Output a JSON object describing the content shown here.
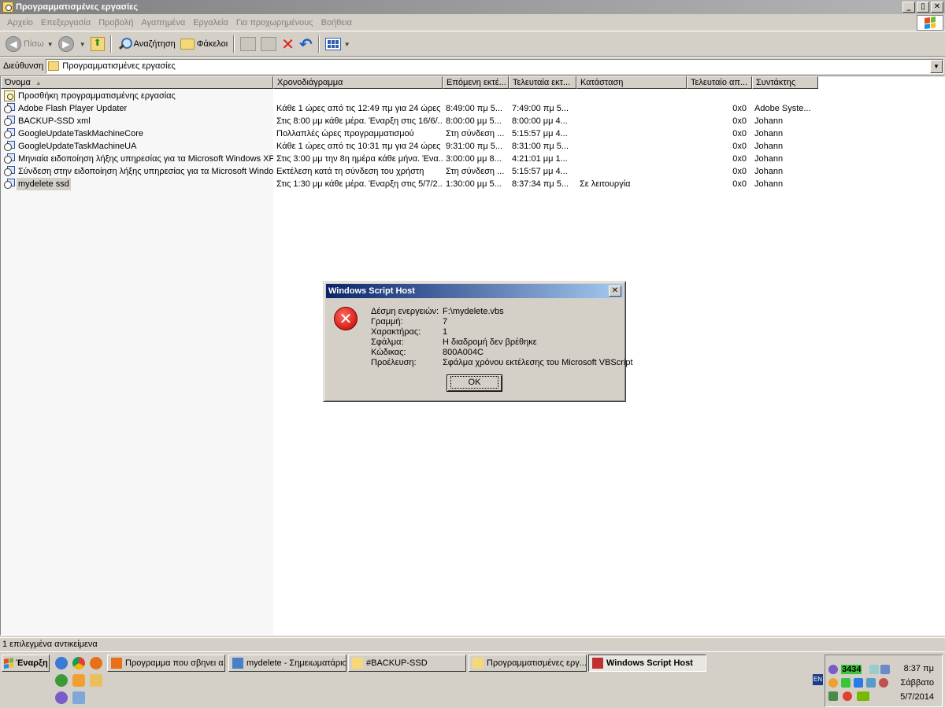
{
  "window": {
    "title": "Προγραμματισμένες εργασίες",
    "minimize": "_",
    "restore": "▯",
    "close": "✕"
  },
  "menu": [
    "Αρχείο",
    "Επεξεργασία",
    "Προβολή",
    "Αγαπημένα",
    "Εργαλεία",
    "Για προχωρημένους",
    "Βοήθεια"
  ],
  "toolbar": {
    "back": "Πίσω",
    "search": "Αναζήτηση",
    "folders": "Φάκελοι"
  },
  "address": {
    "label": "Διεύθυνση",
    "value": "Προγραμματισμένες εργασίες"
  },
  "columns": [
    "Όνομα",
    "Χρονοδιάγραμμα",
    "Επόμενη εκτέ...",
    "Τελευταία εκτ...",
    "Κατάσταση",
    "Τελευταίο απ...",
    "Συντάκτης"
  ],
  "add_task": "Προσθήκη προγραμματισμένης εργασίας",
  "tasks": [
    {
      "name": "Adobe Flash Player Updater",
      "schedule": "Κάθε 1 ώρες από τις 12:49 πμ για 24 ώρες ...",
      "next": "8:49:00 πμ  5...",
      "last": "7:49:00 πμ  5...",
      "status": "",
      "result": "0x0",
      "author": "Adobe Syste..."
    },
    {
      "name": "BACKUP-SSD xml",
      "schedule": "Στις 8:00 μμ κάθε μέρα. Έναρξη στις 16/6/...",
      "next": "8:00:00 μμ  5...",
      "last": "8:00:00 μμ  4...",
      "status": "",
      "result": "0x0",
      "author": "Johann"
    },
    {
      "name": "GoogleUpdateTaskMachineCore",
      "schedule": "Πολλαπλές ώρες προγραμματισμού",
      "next": "Στη σύνδεση ...",
      "last": "5:15:57 μμ  4...",
      "status": "",
      "result": "0x0",
      "author": "Johann"
    },
    {
      "name": "GoogleUpdateTaskMachineUA",
      "schedule": "Κάθε 1 ώρες από τις 10:31 πμ για 24 ώρες ...",
      "next": "9:31:00 πμ  5...",
      "last": "8:31:00 πμ  5...",
      "status": "",
      "result": "0x0",
      "author": "Johann"
    },
    {
      "name": "Μηνιαία ειδοποίηση λήξης υπηρεσίας για τα Microsoft Windows XP",
      "schedule": "Στις 3:00 μμ την 8η ημέρα κάθε μήνα. Ένα...",
      "next": "3:00:00 μμ  8...",
      "last": "4:21:01 μμ  1...",
      "status": "",
      "result": "0x0",
      "author": "Johann"
    },
    {
      "name": "Σύνδεση στην ειδοποίηση λήξης υπηρεσίας για τα Microsoft Windows XP",
      "schedule": "Εκτέλεση κατά τη σύνδεση του χρήστη",
      "next": "Στη σύνδεση ...",
      "last": "5:15:57 μμ  4...",
      "status": "",
      "result": "0x0",
      "author": "Johann"
    },
    {
      "name": "mydelete ssd",
      "schedule": "Στις 1:30 μμ κάθε μέρα. Έναρξη στις 5/7/2...",
      "next": "1:30:00 μμ  5...",
      "last": "8:37:34 πμ  5...",
      "status": "Σε λειτουργία",
      "result": "0x0",
      "author": "Johann"
    }
  ],
  "statusbar": "1 επιλεγμένα αντικείμενα",
  "dialog": {
    "title": "Windows Script Host",
    "close": "✕",
    "icon": "✕",
    "fields": [
      {
        "k": "Δέσμη ενεργειών:",
        "v": "F:\\mydelete.vbs"
      },
      {
        "k": "Γραμμή:",
        "v": "7"
      },
      {
        "k": "Χαρακτήρας:",
        "v": "1"
      },
      {
        "k": "Σφάλμα:",
        "v": "Η διαδρομή δεν βρέθηκε"
      },
      {
        "k": "Κώδικας:",
        "v": "800A004C"
      },
      {
        "k": "Προέλευση:",
        "v": "Σφάλμα χρόνου εκτέλεσης του Microsoft VBScript"
      }
    ],
    "ok": "OK"
  },
  "taskbar": {
    "start": "Έναρξη",
    "tasks": [
      {
        "label": "Προγραμμα που σβηνει α...",
        "icon_color": "#e8701a"
      },
      {
        "label": "mydelete - Σημειωματάριο",
        "icon_color": "#4a7fc8"
      },
      {
        "label": "#BACKUP-SSD",
        "icon_color": "#f5d87a"
      },
      {
        "label": "Προγραμματισμένες εργ...",
        "icon_color": "#f5d87a"
      },
      {
        "label": "Windows Script Host",
        "icon_color": "#c03030"
      }
    ],
    "lang": "EN",
    "tray_count": "3434",
    "clock": {
      "time": "8:37 πμ",
      "day": "Σάββατο",
      "date": "5/7/2014"
    }
  }
}
